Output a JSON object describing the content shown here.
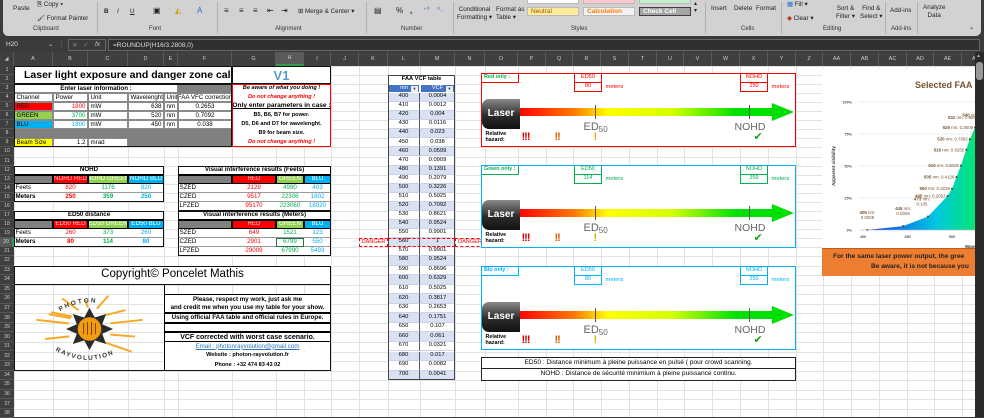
{
  "ribbon": {
    "clipboard": {
      "paste": "Paste",
      "copy": "Copy",
      "format_painter": "Format Painter",
      "label": "Clipboard"
    },
    "font": {
      "bold": "B",
      "italic": "I",
      "underline": "U",
      "label": "Font"
    },
    "alignment": {
      "merge": "Merge & Center",
      "label": "Alignment"
    },
    "number": {
      "percent": "%",
      "comma": ",",
      "label": "Number"
    },
    "styles": {
      "conditional": "Conditional",
      "conditional2": "Formatting",
      "format_table": "Format as",
      "format_table2": "Table",
      "neutral": "Neutral",
      "calculation": "Calculation",
      "check_cell": "Check Cell",
      "label": "Styles"
    },
    "cells": {
      "insert": "Insert",
      "delete": "Delete",
      "format": "Format",
      "label": "Cells"
    },
    "editing": {
      "fill": "Fill",
      "clear": "Clear",
      "sort": "Sort &",
      "sort2": "Filter",
      "find": "Find &",
      "find2": "Select",
      "label": "Editing"
    },
    "addins": {
      "button": "Add-ins",
      "label": "Add-ins"
    },
    "analyze": {
      "line1": "Analyze",
      "line2": "Data"
    }
  },
  "formula_bar": {
    "name_box": "H20",
    "fx": "fx",
    "formula": "=ROUNDUP(H16/3.2808,0)"
  },
  "columns": [
    "A",
    "B",
    "C",
    "D",
    "E",
    "F",
    "G",
    "H",
    "I",
    "J",
    "K",
    "L",
    "M",
    "N",
    "O",
    "P",
    "Q",
    "R",
    "S",
    "T",
    "U",
    "V",
    "W",
    "X",
    "Y",
    "Z",
    "AA",
    "AB",
    "AC",
    "AD",
    "AE",
    "AF"
  ],
  "rows": [
    "1",
    "2",
    "3",
    "4",
    "5",
    "6",
    "7",
    "8",
    "9",
    "10",
    "11",
    "12",
    "13",
    "14",
    "15",
    "16",
    "17",
    "18",
    "19",
    "20",
    "21",
    "22",
    "23",
    "24",
    "25",
    "26",
    "27",
    "28",
    "29",
    "30",
    "31",
    "32",
    "33",
    "34",
    "35",
    "36",
    "37",
    "38"
  ],
  "selected_cell": "H20",
  "sheet": {
    "title": "Laser light exposure and danger zone calculator :",
    "version": "V1",
    "laser_info": {
      "heading": "Enter laser information :",
      "headers": [
        "Channel",
        "Power",
        "Unit",
        "Wavelenght",
        "Unit",
        "FAA VFC correction"
      ],
      "rows": [
        [
          "RED",
          "1800",
          "mW",
          "638",
          "nm",
          "0.2653"
        ],
        [
          "GREEN",
          "3700",
          "mW",
          "520",
          "nm",
          "0.7092"
        ],
        [
          "BLU",
          "1800",
          "mW",
          "450",
          "nm",
          "0.038"
        ]
      ],
      "beam": [
        "Beam Size",
        "1.2",
        "mrad"
      ]
    },
    "warnings": [
      "Be aware of what you doing !",
      "Do not change anything !",
      "Only enter parameters in case :",
      "B5, B6, B7 for power.",
      "D5, D6 and D7 for wavelenght.",
      "B9 for beam size.",
      "Do not change anything !"
    ],
    "nohd": {
      "title": "NOHD",
      "headers": [
        "NOHD RED",
        "NOHD GREEN",
        "NOHD BLU"
      ],
      "rows": [
        [
          "Feets",
          "820",
          "1176",
          "820"
        ],
        [
          "Meters",
          "250",
          "359",
          "250"
        ]
      ]
    },
    "ed50": {
      "title": "ED50 distance",
      "headers": [
        "ED50 RED",
        "ED50 GREEN",
        "ED50 BLU"
      ],
      "rows": [
        [
          "Feets",
          "260",
          "373",
          "260"
        ],
        [
          "Meters",
          "80",
          "114",
          "80"
        ]
      ]
    },
    "vi_feet": {
      "title": "Visual interference results (Feets)",
      "headers": [
        "RED",
        "GREEN",
        "BLU"
      ],
      "rows": [
        [
          "SZED",
          "2129",
          "4990",
          "403"
        ],
        [
          "CZED",
          "9517",
          "22306",
          "1802"
        ],
        [
          "LFZED",
          "95170",
          "223060",
          "18020"
        ]
      ]
    },
    "vi_meters": {
      "title": "Visual interference results (Meters)",
      "headers": [
        "RED",
        "GREEN",
        "BLU"
      ],
      "rows": [
        [
          "SZED",
          "649",
          "1521",
          "123"
        ],
        [
          "CZED",
          "2901",
          "6799",
          "550"
        ],
        [
          "LFZED",
          "29009",
          "67990",
          "5493"
        ]
      ]
    },
    "copyright": "Copyright© Poncelet Mathis",
    "logo": {
      "top": "PHOTON",
      "bottom": "RAYVOLUTION"
    },
    "credits": [
      "Please, respect my work, just ask me",
      "and credit me when you use my table for your show.",
      "Using official FAA table and official rules in Europe.",
      "VCF corrected with worst case scenario.",
      "Email : photonrayvolution@gmail.com",
      "Website : photon-rayvolution.fr",
      "Phone : +32 474 83 43 02"
    ],
    "faa": {
      "title": "FAA VCF table",
      "headers": [
        "nm",
        "VCF"
      ],
      "rows": [
        [
          "400",
          "0.0004"
        ],
        [
          "410",
          "0.0012"
        ],
        [
          "420",
          "0.004"
        ],
        [
          "430",
          "0.0116"
        ],
        [
          "440",
          "0.023"
        ],
        [
          "450",
          "0.038"
        ],
        [
          "460",
          "0.0599"
        ],
        [
          "470",
          "0.0909"
        ],
        [
          "480",
          "0.1391"
        ],
        [
          "490",
          "0.2079"
        ],
        [
          "500",
          "0.3226"
        ],
        [
          "510",
          "0.5025"
        ],
        [
          "520",
          "0.7092"
        ],
        [
          "530",
          "0.8621"
        ],
        [
          "540",
          "0.9524"
        ],
        [
          "550",
          "0.9901"
        ],
        [
          "560",
          "1"
        ],
        [
          "570",
          "0.9901"
        ],
        [
          "580",
          "0.9524"
        ],
        [
          "590",
          "0.8696"
        ],
        [
          "600",
          "0.6329"
        ],
        [
          "610",
          "0.5025"
        ],
        [
          "620",
          "0.3817"
        ],
        [
          "630",
          "0.2653"
        ],
        [
          "640",
          "0.1751"
        ],
        [
          "650",
          "0.107"
        ],
        [
          "660",
          "0.061"
        ],
        [
          "670",
          "0.0321"
        ],
        [
          "680",
          "0.017"
        ],
        [
          "690",
          "0.0082"
        ],
        [
          "700",
          "0.0041"
        ]
      ]
    },
    "danger": "DANGER",
    "zones": [
      {
        "label": "Red only :",
        "ed50_label": "ED50",
        "ed50": "80",
        "nohd_label": "NOHD",
        "nohd": "250",
        "unit": "meters",
        "colors": {
          "border": "#ff0000",
          "label": "#00b050",
          "box": "#ff0000",
          "value": "#ff0000"
        }
      },
      {
        "label": "Green only :",
        "ed50_label": "ED50",
        "ed50": "114",
        "nohd_label": "NOHD",
        "nohd": "359",
        "unit": "meters",
        "colors": {
          "border": "#00b0f0",
          "label": "#00b050",
          "box": "#00b050",
          "value": "#00b050"
        }
      },
      {
        "label": "Blu only :",
        "ed50_label": "ED50",
        "ed50": "80",
        "nohd_label": "NOHD",
        "nohd": "250",
        "unit": "meters",
        "colors": {
          "border": "#00b0f0",
          "label": "#00b0f0",
          "box": "#00b0f0",
          "value": "#00b0f0"
        }
      }
    ],
    "zone_graphic": {
      "laser": "Laser",
      "ed": "ED",
      "ed_sub": "50",
      "nohd": "NOHD",
      "hazard1": "Relative",
      "hazard2": "hazard:",
      "mark_high": "!!!",
      "mark_mid": "!!",
      "mark_low": "!",
      "mark_safe": "✔"
    },
    "legend": [
      "ED50 : Distance minimum à pleine puissance en pulsé ( pour crowd scanning.",
      "NOHD : Distance de sécurité minimium à pleine puissance continu."
    ],
    "banner": [
      "For the same laser power output, the gree",
      "Be aware, it is not because you"
    ]
  },
  "chart_data": {
    "type": "area",
    "title": "Selected FAA",
    "xlabel": "Wave",
    "ylabel": "Apparent visibility",
    "xlim": [
      400,
      560
    ],
    "ylim": [
      0,
      1
    ],
    "x_ticks": [
      "400",
      "450",
      "500"
    ],
    "y_ticks": [
      "0%",
      "25%",
      "50%",
      "75%",
      "100%"
    ],
    "grid": true,
    "points": [
      {
        "nm": 405,
        "v": "0.0008"
      },
      {
        "nm": 445,
        "v": "0.0305"
      },
      {
        "nm": 473,
        "v": "0.105"
      },
      {
        "nm": 495,
        "v": "0.2653"
      },
      {
        "nm": 500,
        "v": "0.3226"
      },
      {
        "nm": 505,
        "v": "0.4126"
      },
      {
        "nm": 510,
        "v": "0.5025"
      },
      {
        "nm": 516,
        "v": "0.6265"
      },
      {
        "nm": 520,
        "v": "0.7092"
      },
      {
        "nm": 526,
        "v": "0.8009"
      },
      {
        "nm": 532,
        "v": "0.8800"
      },
      {
        "nm": 540,
        "v": "0.9"
      }
    ],
    "colors": {
      "start": "#1b3cf0",
      "mid": "#00c8e0",
      "end": "#00e676",
      "label": "#7a5230"
    }
  }
}
